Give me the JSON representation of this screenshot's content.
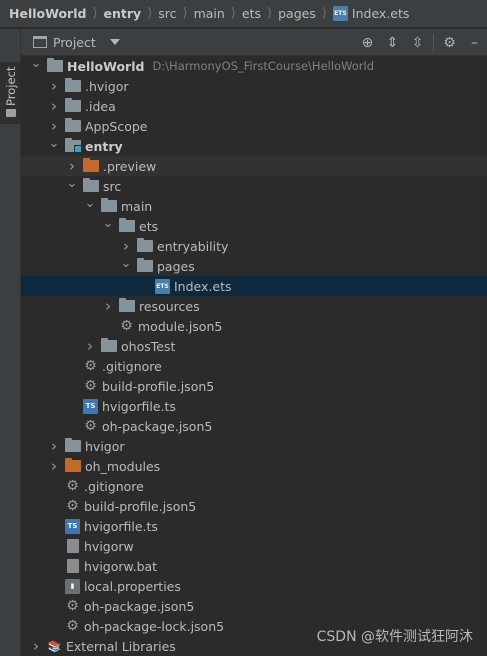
{
  "breadcrumb": [
    "HelloWorld",
    "entry",
    "src",
    "main",
    "ets",
    "pages",
    "Index.ets"
  ],
  "stripe": {
    "label": "Project"
  },
  "panel": {
    "title": "Project",
    "tools": [
      "target-icon",
      "expand-all-icon",
      "collapse-all-icon",
      "gear-icon",
      "minimize-icon"
    ]
  },
  "tree": [
    {
      "label": "HelloWorld",
      "path": "D:\\HarmonyOS_FirstCourse\\HelloWorld",
      "depth": 0,
      "arrow": "down",
      "icon": "folder"
    },
    {
      "label": ".hvigor",
      "depth": 1,
      "arrow": "right",
      "icon": "folder"
    },
    {
      "label": ".idea",
      "depth": 1,
      "arrow": "right",
      "icon": "folder"
    },
    {
      "label": "AppScope",
      "depth": 1,
      "arrow": "right",
      "icon": "folder"
    },
    {
      "label": "entry",
      "depth": 1,
      "arrow": "down",
      "icon": "module"
    },
    {
      "label": ".preview",
      "depth": 2,
      "arrow": "right",
      "icon": "orange"
    },
    {
      "label": "src",
      "depth": 2,
      "arrow": "down",
      "icon": "folder"
    },
    {
      "label": "main",
      "depth": 3,
      "arrow": "down",
      "icon": "folder"
    },
    {
      "label": "ets",
      "depth": 4,
      "arrow": "down",
      "icon": "folder"
    },
    {
      "label": "entryability",
      "depth": 5,
      "arrow": "right",
      "icon": "folder"
    },
    {
      "label": "pages",
      "depth": 5,
      "arrow": "down",
      "icon": "folder"
    },
    {
      "label": "Index.ets",
      "depth": 6,
      "arrow": "none",
      "icon": "ets"
    },
    {
      "label": "resources",
      "depth": 4,
      "arrow": "right",
      "icon": "folder"
    },
    {
      "label": "module.json5",
      "depth": 4,
      "arrow": "none",
      "icon": "gear"
    },
    {
      "label": "ohosTest",
      "depth": 3,
      "arrow": "right",
      "icon": "folder"
    },
    {
      "label": ".gitignore",
      "depth": 2,
      "arrow": "none",
      "icon": "gear"
    },
    {
      "label": "build-profile.json5",
      "depth": 2,
      "arrow": "none",
      "icon": "gear"
    },
    {
      "label": "hvigorfile.ts",
      "depth": 2,
      "arrow": "none",
      "icon": "ts"
    },
    {
      "label": "oh-package.json5",
      "depth": 2,
      "arrow": "none",
      "icon": "gear"
    },
    {
      "label": "hvigor",
      "depth": 1,
      "arrow": "right",
      "icon": "folder"
    },
    {
      "label": "oh_modules",
      "depth": 1,
      "arrow": "right",
      "icon": "orange"
    },
    {
      "label": ".gitignore",
      "depth": 1,
      "arrow": "none",
      "icon": "gear"
    },
    {
      "label": "build-profile.json5",
      "depth": 1,
      "arrow": "none",
      "icon": "gear"
    },
    {
      "label": "hvigorfile.ts",
      "depth": 1,
      "arrow": "none",
      "icon": "ts"
    },
    {
      "label": "hvigorw",
      "depth": 1,
      "arrow": "none",
      "icon": "file"
    },
    {
      "label": "hvigorw.bat",
      "depth": 1,
      "arrow": "none",
      "icon": "file"
    },
    {
      "label": "local.properties",
      "depth": 1,
      "arrow": "none",
      "icon": "chart"
    },
    {
      "label": "oh-package.json5",
      "depth": 1,
      "arrow": "none",
      "icon": "gear"
    },
    {
      "label": "oh-package-lock.json5",
      "depth": 1,
      "arrow": "none",
      "icon": "gear"
    },
    {
      "label": "External Libraries",
      "depth": 0,
      "arrow": "right",
      "icon": "lib"
    }
  ],
  "selected_label": "Index.ets",
  "highlighted_label": ".preview",
  "watermark": "CSDN @软件测试狂阿沐",
  "colors": {
    "background": "#2b2b2b",
    "toolbar": "#3c3f41",
    "selection": "#0d293e",
    "folder": "#87939a",
    "excluded_folder": "#c56a2c"
  }
}
